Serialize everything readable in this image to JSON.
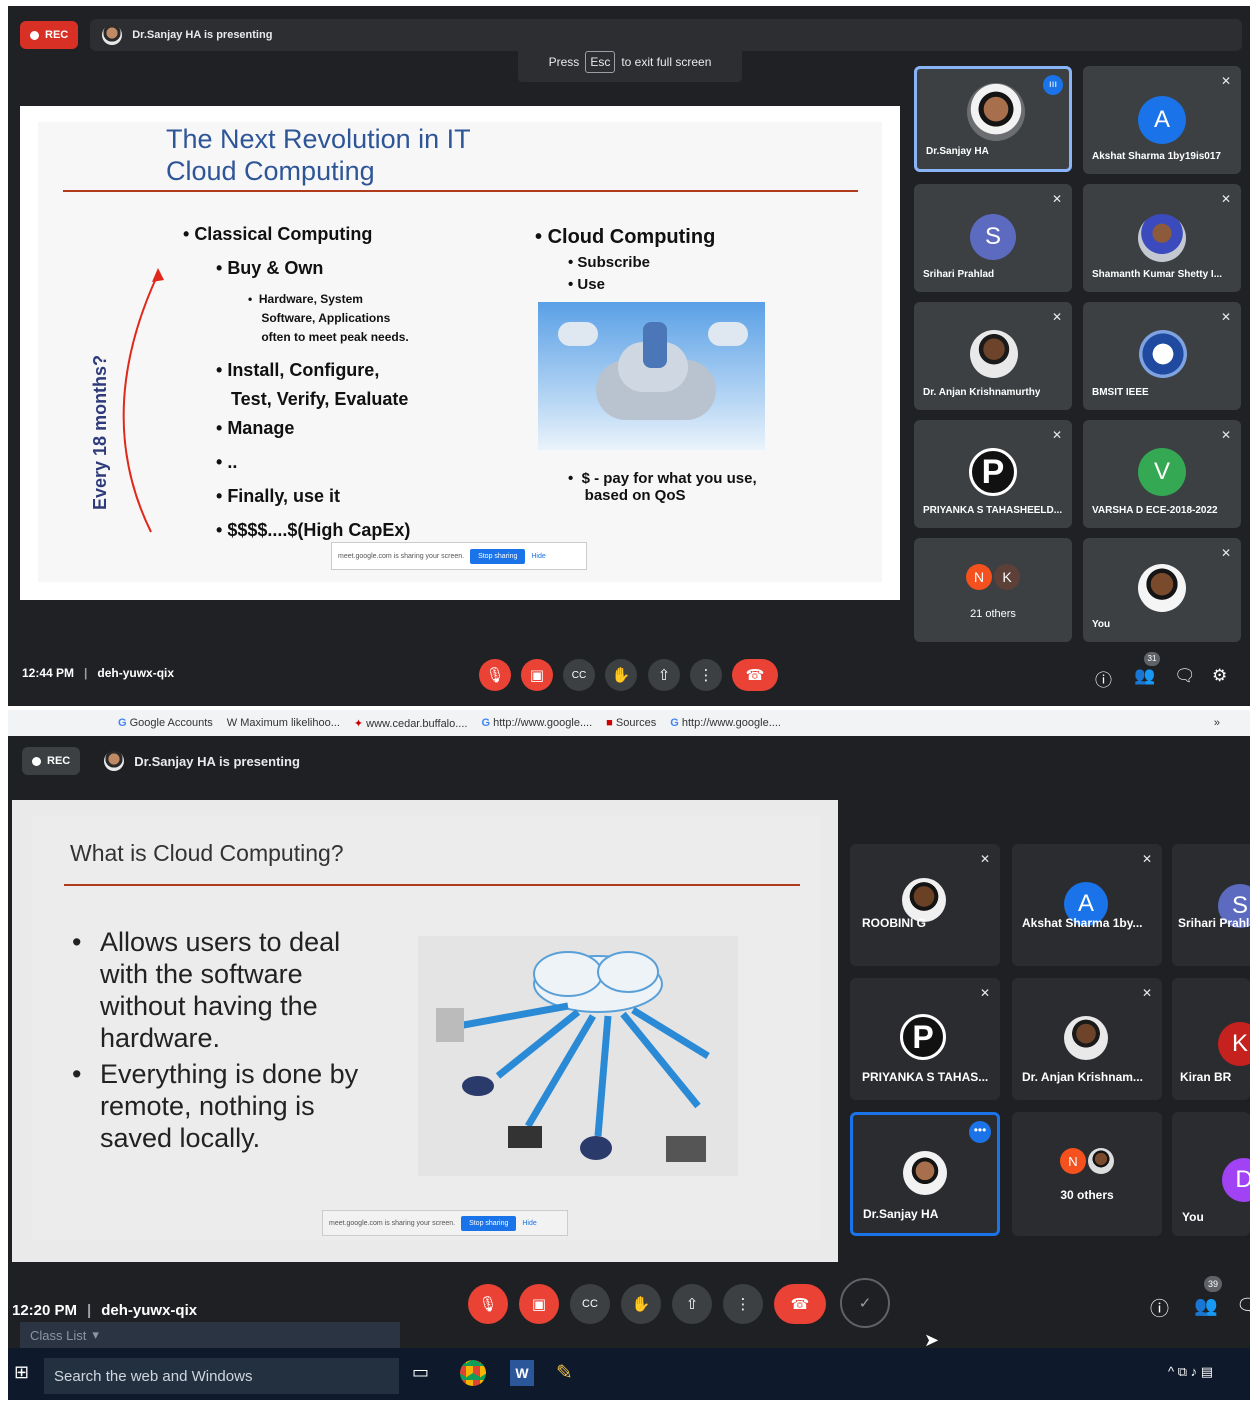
{
  "screen1": {
    "rec": "REC",
    "presenting": "Dr.Sanjay HA is presenting",
    "esc_press": "Press",
    "esc_key": "Esc",
    "esc_tail": "to exit full screen",
    "slide": {
      "title1": "The Next Revolution in IT",
      "title2": "Cloud Computing",
      "side_label": "Every 18 months?",
      "classical": "Classical Computing",
      "buy_own": "Buy & Own",
      "hw1": "Hardware, System",
      "hw2": "Software, Applications",
      "hw3": "often to meet peak needs.",
      "install1": "Install, Configure,",
      "install2": "Test, Verify, Evaluate",
      "manage": "Manage",
      "dots": "..",
      "finally": "Finally, use it",
      "capex": "$$$$....$(High CapEx)",
      "cloud": "Cloud Computing",
      "subscribe": "Subscribe",
      "use": "Use",
      "pay1": "$ - pay for what you use,",
      "pay2": "based on QoS"
    },
    "share_notice": {
      "text": "meet.google.com is sharing your screen.",
      "stop": "Stop sharing",
      "hide": "Hide"
    },
    "tiles": [
      {
        "name": "Dr.Sanjay HA"
      },
      {
        "name": "Akshat Sharma 1by19is017",
        "letter": "A",
        "color": "#1a73e8"
      },
      {
        "name": "Srihari Prahlad",
        "letter": "S",
        "color": "#5c6bc0"
      },
      {
        "name": "Shamanth Kumar Shetty I..."
      },
      {
        "name": "Dr. Anjan Krishnamurthy"
      },
      {
        "name": "BMSIT IEEE"
      },
      {
        "name": "PRIYANKA S TAHASHEELD...",
        "letter": "P",
        "color": "#111111"
      },
      {
        "name": "VARSHA D ECE-2018-2022",
        "letter": "V",
        "color": "#34a853"
      },
      {
        "name": "21 others",
        "letters": [
          "N",
          "K"
        ]
      },
      {
        "name": "You"
      }
    ],
    "time": "12:44 PM",
    "meeting_code": "deh-yuwx-qix",
    "people_count": "31"
  },
  "screen2": {
    "bookmarks": [
      "Google Accounts",
      "Maximum likelihoo...",
      "www.cedar.buffalo....",
      "http://www.google....",
      "Sources",
      "http://www.google...."
    ],
    "bookmark_more": "»",
    "rec": "REC",
    "presenting": "Dr.Sanjay HA is presenting",
    "slide": {
      "title": "What is Cloud Computing?",
      "b1": [
        "Allows users to deal",
        "with the software",
        "without having the",
        "hardware."
      ],
      "b2": [
        "Everything is done by",
        "remote, nothing is",
        "saved locally."
      ]
    },
    "share_notice": {
      "text": "meet.google.com is sharing your screen.",
      "stop": "Stop sharing",
      "hide": "Hide"
    },
    "tiles": [
      {
        "name": "ROOBINI G"
      },
      {
        "name": "Akshat Sharma 1by...",
        "letter": "A",
        "color": "#1a73e8"
      },
      {
        "name": "Srihari Prahla",
        "letter": "S",
        "color": "#5c6bc0"
      },
      {
        "name": "PRIYANKA S TAHAS...",
        "letter": "P",
        "color": "#111111"
      },
      {
        "name": "Dr. Anjan Krishnam..."
      },
      {
        "name": "Kiran BR",
        "letter": "K",
        "color": "#c5221f"
      },
      {
        "name": "Dr.Sanjay HA"
      },
      {
        "name": "30 others",
        "letters": [
          "N"
        ]
      },
      {
        "name": "You",
        "letter": "D",
        "color": "#a142f4"
      }
    ],
    "time": "12:20 PM",
    "meeting_code": "deh-yuwx-qix",
    "people_count": "39",
    "class_list": "Class List",
    "search": "Search the web and Windows"
  }
}
